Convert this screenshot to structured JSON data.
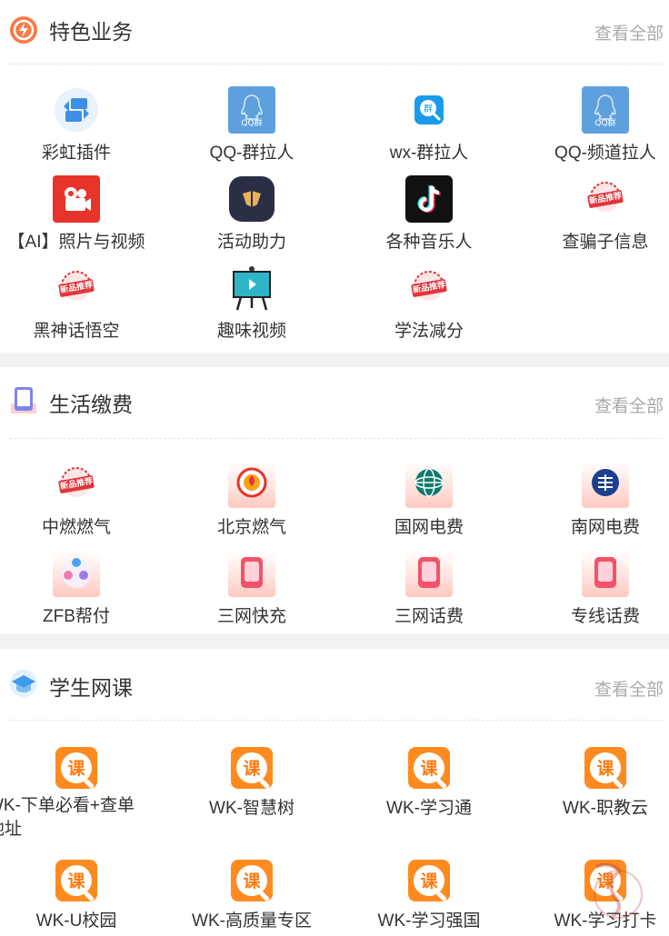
{
  "sections": [
    {
      "title": "特色业务",
      "more": "查看全部",
      "items": [
        {
          "label": "彩虹插件",
          "icon": "swap-icon"
        },
        {
          "label": "QQ-群拉人",
          "icon": "qq-group-icon"
        },
        {
          "label": "wx-群拉人",
          "icon": "group-search-icon"
        },
        {
          "label": "QQ-频道拉人",
          "icon": "qq-group-icon"
        },
        {
          "label": "【AI】照片与视频",
          "icon": "camera-icon"
        },
        {
          "label": "活动助力",
          "icon": "activity-icon"
        },
        {
          "label": "各种音乐人",
          "icon": "tiktok-icon"
        },
        {
          "label": "查骗子信息",
          "icon": "new-badge-icon"
        },
        {
          "label": "黑神话悟空",
          "icon": "new-badge-icon"
        },
        {
          "label": "趣味视频",
          "icon": "board-icon"
        },
        {
          "label": "学法减分",
          "icon": "new-badge-icon"
        }
      ]
    },
    {
      "title": "生活缴费",
      "more": "查看全部",
      "items": [
        {
          "label": "中燃燃气",
          "icon": "new-badge-icon"
        },
        {
          "label": "北京燃气",
          "icon": "gas-icon"
        },
        {
          "label": "国网电费",
          "icon": "state-grid-icon"
        },
        {
          "label": "南网电费",
          "icon": "south-grid-icon"
        },
        {
          "label": "ZFB帮付",
          "icon": "bubbles-icon"
        },
        {
          "label": "三网快充",
          "icon": "phone-icon"
        },
        {
          "label": "三网话费",
          "icon": "phone-icon"
        },
        {
          "label": "专线话费",
          "icon": "phone-icon"
        }
      ]
    },
    {
      "title": "学生网课",
      "more": "查看全部",
      "items": [
        {
          "label": "WK-下单必看+查单地址",
          "icon": "course-icon"
        },
        {
          "label": "WK-智慧树",
          "icon": "course-icon"
        },
        {
          "label": "WK-学习通",
          "icon": "course-icon"
        },
        {
          "label": "WK-职教云",
          "icon": "course-icon"
        },
        {
          "label": "WK-U校园",
          "icon": "course-icon"
        },
        {
          "label": "WK-高质量专区",
          "icon": "course-icon"
        },
        {
          "label": "WK-学习强国",
          "icon": "course-icon"
        },
        {
          "label": "WK-学习打卡",
          "icon": "course-icon"
        }
      ]
    }
  ],
  "icon_text": {
    "qq_group": "QQ群",
    "new_badge": "新品推荐",
    "course": "课",
    "group": "群"
  },
  "colors": {
    "accent_orange": "#ff8a1f",
    "more_text": "#aaaaaa",
    "divider_bg": "#f2f2f2"
  }
}
